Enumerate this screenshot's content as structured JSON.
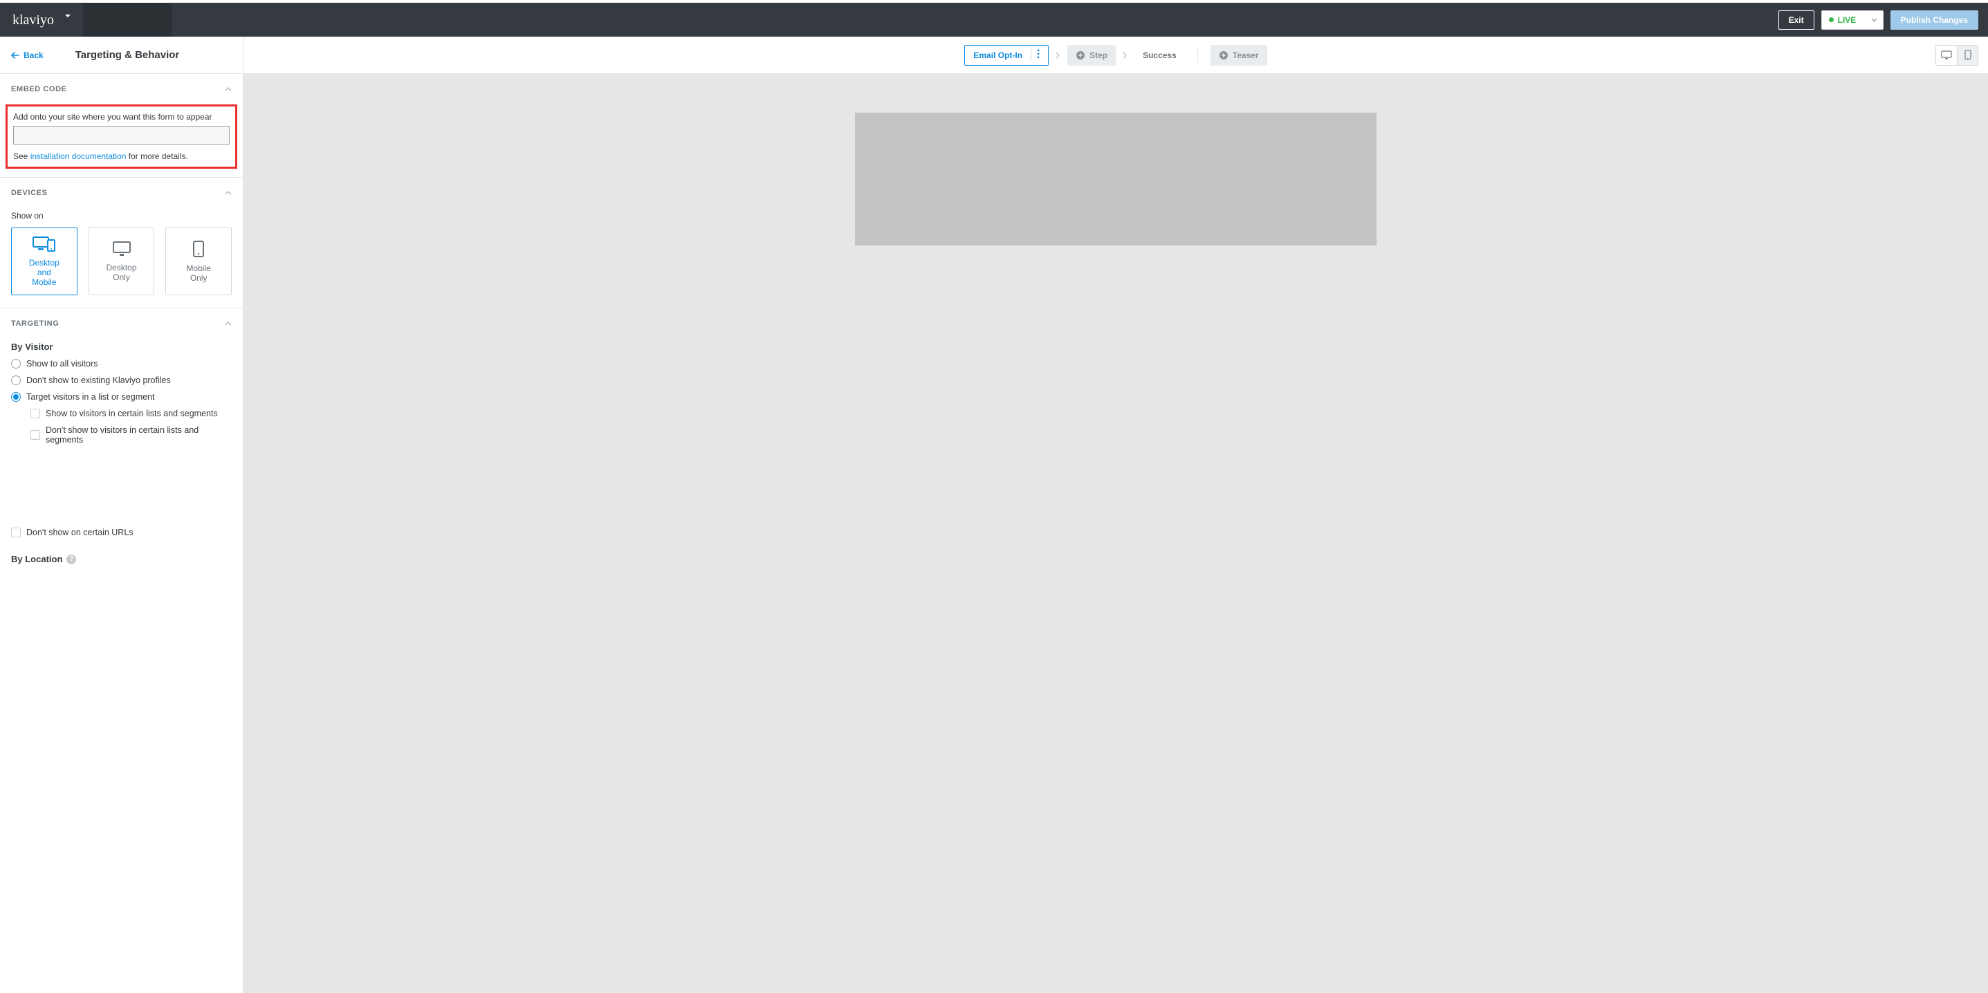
{
  "brand": {
    "name": "klaviyo"
  },
  "header": {
    "exit_label": "Exit",
    "live_label": "LIVE",
    "publish_label": "Publish Changes"
  },
  "sidebar": {
    "back_label": "Back",
    "title": "Targeting & Behavior",
    "sections": {
      "embed": {
        "title": "EMBED CODE",
        "label": "Add onto your site where you want this form to appear",
        "value": "",
        "help_prefix": "See ",
        "help_link_text": "installation documentation",
        "help_suffix": " for more details."
      },
      "devices": {
        "title": "DEVICES",
        "show_on_label": "Show on",
        "options": [
          {
            "label": "Desktop\nand\nMobile",
            "selected": true
          },
          {
            "label": "Desktop\nOnly",
            "selected": false
          },
          {
            "label": "Mobile\nOnly",
            "selected": false
          }
        ]
      },
      "targeting": {
        "title": "TARGETING",
        "by_visitor_heading": "By Visitor",
        "radios": [
          {
            "label": "Show to all visitors",
            "checked": false
          },
          {
            "label": "Don't show to existing Klaviyo profiles",
            "checked": false
          },
          {
            "label": "Target visitors in a list or segment",
            "checked": true
          }
        ],
        "sub_checks": [
          {
            "label": "Show to visitors in certain lists and segments"
          },
          {
            "label": "Don't show to visitors in certain lists and segments"
          }
        ],
        "url_check_label": "Don't show on certain URLs",
        "by_location_heading": "By Location"
      }
    }
  },
  "steps": {
    "active": "Email Opt-In",
    "add_step": "Step",
    "success": "Success",
    "teaser": "Teaser"
  }
}
